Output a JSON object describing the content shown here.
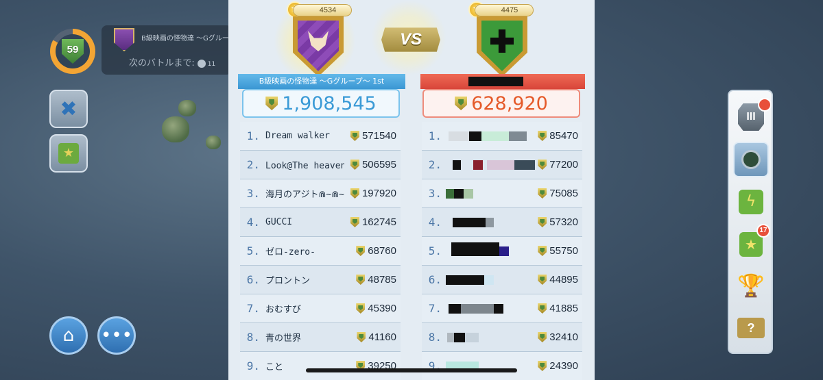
{
  "hud": {
    "level": "59",
    "clan_name": "B級映画の怪物達 ～Gグルー",
    "next_battle_label": "次のバトルまで:",
    "next_battle_timer": "11"
  },
  "war": {
    "vs_label": "VS",
    "left": {
      "clan_score": "4534",
      "banner": "B級映画の怪物達 ～Gグループ～ 1st",
      "total": "1,908,545",
      "members": [
        {
          "rank": "1.",
          "name": "Dream walker",
          "points": "571540"
        },
        {
          "rank": "2.",
          "name": "Look@The heaven(ルク)",
          "points": "506595"
        },
        {
          "rank": "3.",
          "name": "海月のアジト⋒~⋒~⋒~",
          "points": "197920"
        },
        {
          "rank": "4.",
          "name": "GUCCI",
          "points": "162745"
        },
        {
          "rank": "5.",
          "name": "ゼロ-zero-",
          "points": "68760"
        },
        {
          "rank": "6.",
          "name": "プロントン",
          "points": "48785"
        },
        {
          "rank": "7.",
          "name": "おむすび",
          "points": "45390"
        },
        {
          "rank": "8.",
          "name": "青の世界",
          "points": "41160"
        },
        {
          "rank": "9.",
          "name": "こと",
          "points": "39250"
        }
      ]
    },
    "right": {
      "clan_score": "4475",
      "banner": "",
      "total": "628,920",
      "members": [
        {
          "rank": "1.",
          "points": "85470"
        },
        {
          "rank": "2.",
          "points": "77200"
        },
        {
          "rank": "3.",
          "points": "75085"
        },
        {
          "rank": "4.",
          "points": "57320"
        },
        {
          "rank": "5.",
          "points": "55750"
        },
        {
          "rank": "6.",
          "points": "44895"
        },
        {
          "rank": "7.",
          "points": "41885"
        },
        {
          "rank": "8.",
          "points": "32410"
        },
        {
          "rank": "9.",
          "points": "24390"
        }
      ]
    }
  },
  "side_menu": {
    "items": [
      {
        "name": "clan-castle-button",
        "icon": "castle-icon",
        "badge": ""
      },
      {
        "name": "war-scope-button",
        "icon": "spyglass-icon",
        "badge": ""
      },
      {
        "name": "power-button",
        "icon": "lightning-icon",
        "badge": ""
      },
      {
        "name": "star-rewards-button",
        "icon": "star-bag-icon",
        "badge": "17"
      },
      {
        "name": "trophy-button",
        "icon": "trophy-icon",
        "badge": ""
      },
      {
        "name": "help-book-button",
        "icon": "help-book-icon",
        "badge": ""
      }
    ]
  },
  "colors": {
    "left_accent": "#4aa6e0",
    "right_accent": "#e14c3c",
    "left_total_text": "#3a9ad6",
    "right_total_text": "#e55a2a"
  }
}
